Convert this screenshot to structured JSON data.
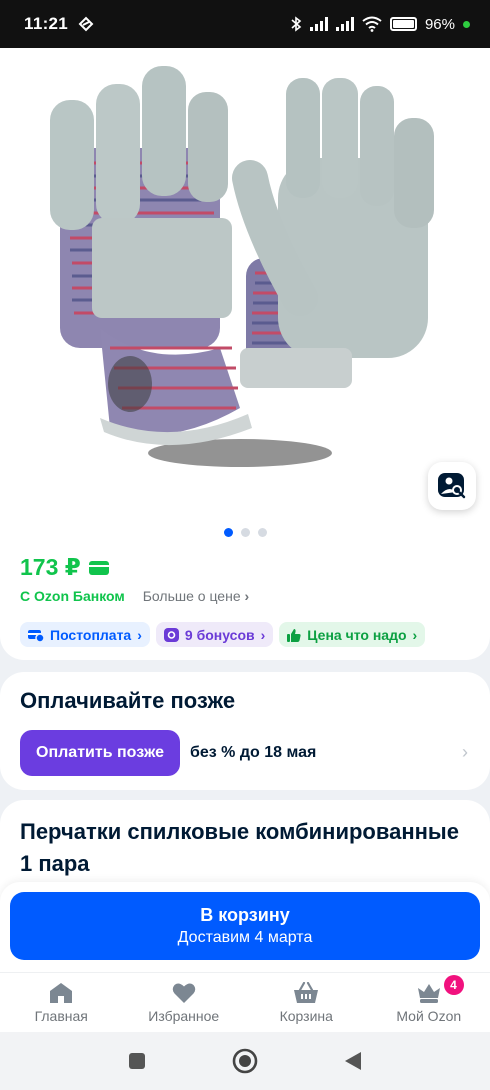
{
  "status_bar": {
    "time": "11:21",
    "battery": "96%"
  },
  "product": {
    "gallery": {
      "image_count": 3,
      "active_index": 0
    },
    "price": "173 ₽",
    "bank_label": "С Ozon Банком",
    "price_info_link": "Больше о цене",
    "chips": [
      {
        "label": "Постоплата",
        "icon": "card-clock-icon"
      },
      {
        "label": "9 бонусов",
        "icon": "ozon-coin-icon"
      },
      {
        "label": "Цена что надо",
        "icon": "thumbs-up-icon"
      }
    ],
    "title": "Перчатки спилковые комбинированные 1 пара"
  },
  "pay_later": {
    "heading": "Оплачивайте позже",
    "button": "Оплатить позже",
    "text": "без % до 18 мая"
  },
  "cta": {
    "label": "В корзину",
    "sublabel": "Доставим 4 марта"
  },
  "tabbar": {
    "items": [
      {
        "label": "Главная",
        "icon": "home-icon"
      },
      {
        "label": "Избранное",
        "icon": "heart-icon"
      },
      {
        "label": "Корзина",
        "icon": "basket-icon"
      },
      {
        "label": "Мой Ozon",
        "icon": "my-ozon-icon",
        "badge": "4"
      }
    ]
  },
  "colors": {
    "accent": "#005bff",
    "price_green": "#10c44c",
    "pay_later_purple": "#6b3de0",
    "badge_pink": "#f1117e"
  }
}
